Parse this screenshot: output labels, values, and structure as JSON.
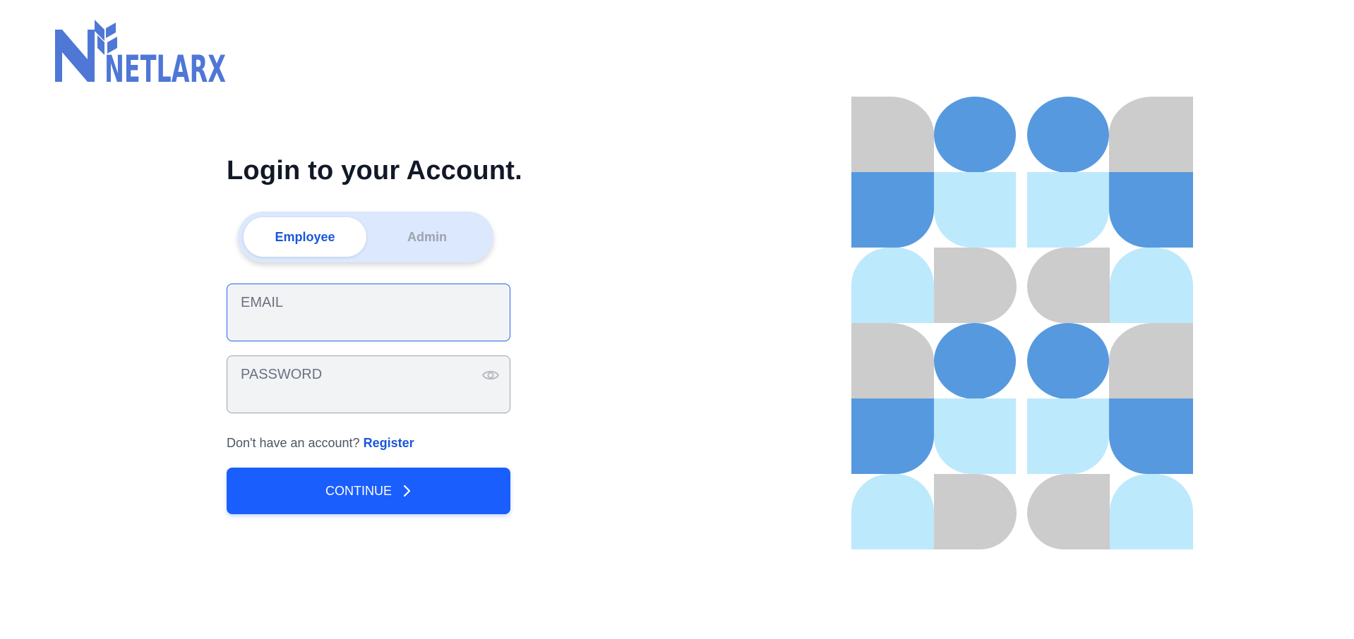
{
  "brand": {
    "name": "NETLARX",
    "color": "#4e77d6"
  },
  "login": {
    "title": "Login to your Account.",
    "tabs": [
      {
        "label": "Employee",
        "active": true
      },
      {
        "label": "Admin",
        "active": false
      }
    ],
    "email": {
      "placeholder": "EMAIL",
      "value": ""
    },
    "password": {
      "placeholder": "PASSWORD",
      "value": "",
      "toggle_icon": "eye-icon"
    },
    "register_prompt": "Don't have an account?",
    "register_link": "Register",
    "continue_label": "CONTINUE",
    "continue_icon": "chevron-right-icon"
  },
  "colors": {
    "accent": "#1a5efd",
    "link": "#1a56db",
    "toggle_bg": "#dbe8fd",
    "pattern_gray": "#cccccc",
    "pattern_blue": "#5799df",
    "pattern_light": "#bde9fc"
  }
}
